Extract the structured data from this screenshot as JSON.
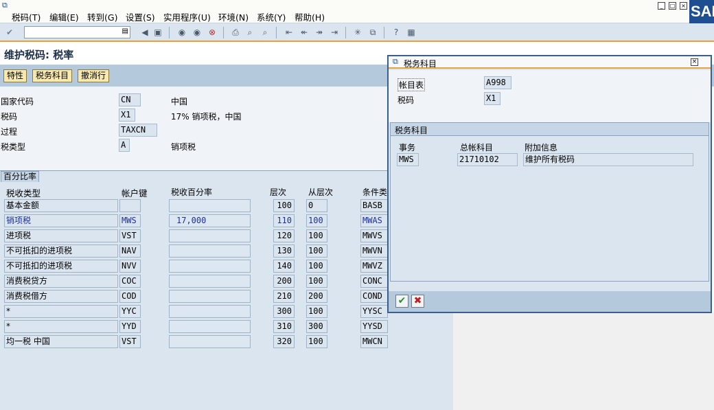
{
  "menu": {
    "items": [
      "税码(T)",
      "编辑(E)",
      "转到(G)",
      "设置(S)",
      "实用程序(U)",
      "环境(N)",
      "系统(Y)",
      "帮助(H)"
    ]
  },
  "logo_text": "SAP",
  "page_title": "维护税码: 税率",
  "app_buttons": [
    "特性",
    "税务科目",
    "撤消行"
  ],
  "header": {
    "country_label": "国家代码",
    "country_value": "CN",
    "country_desc": "中国",
    "taxcode_label": "税码",
    "taxcode_value": "X1",
    "taxcode_desc": "17% 销项税，中国",
    "procedure_label": "过程",
    "procedure_value": "TAXCN",
    "taxtype_label": "税类型",
    "taxtype_value": "A",
    "taxtype_desc": "销项税"
  },
  "table": {
    "tab_label": "百分比率",
    "columns": [
      "税收类型",
      "帐户键",
      "税收百分率",
      "层次",
      "从层次",
      "条件类"
    ],
    "rows": [
      {
        "type": "基本金额",
        "key": "",
        "pct": "",
        "level": "100",
        "from": "0",
        "cond": "BASB",
        "hl": false
      },
      {
        "type": "销项税",
        "key": "MWS",
        "pct": "17,000",
        "level": "110",
        "from": "100",
        "cond": "MWAS",
        "hl": true
      },
      {
        "type": "进项税",
        "key": "VST",
        "pct": "",
        "level": "120",
        "from": "100",
        "cond": "MWVS",
        "hl": false
      },
      {
        "type": "不可抵扣的进项税",
        "key": "NAV",
        "pct": "",
        "level": "130",
        "from": "100",
        "cond": "MWVN",
        "hl": false
      },
      {
        "type": "不可抵扣的进项税",
        "key": "NVV",
        "pct": "",
        "level": "140",
        "from": "100",
        "cond": "MWVZ",
        "hl": false
      },
      {
        "type": "消费税贷方",
        "key": "COC",
        "pct": "",
        "level": "200",
        "from": "100",
        "cond": "CONC",
        "hl": false
      },
      {
        "type": "消费税借方",
        "key": "COD",
        "pct": "",
        "level": "210",
        "from": "200",
        "cond": "COND",
        "hl": false
      },
      {
        "type": "*",
        "key": "YYC",
        "pct": "",
        "level": "300",
        "from": "100",
        "cond": "YYSC",
        "hl": false
      },
      {
        "type": "*",
        "key": "YYD",
        "pct": "",
        "level": "310",
        "from": "300",
        "cond": "YYSD",
        "hl": false
      },
      {
        "type": "均一税 中国",
        "key": "VST",
        "pct": "",
        "level": "320",
        "from": "100",
        "cond": "MWCN",
        "hl": false
      }
    ]
  },
  "dialog": {
    "title": "税务科目",
    "chart_label": "帐目表",
    "chart_value": "A998",
    "taxcode_label": "税码",
    "taxcode_value": "X1",
    "section_label": "税务科目",
    "col_tx": "事务",
    "col_account": "总帐科目",
    "col_info": "附加信息",
    "row_tx": "MWS",
    "row_account": "21710102",
    "row_info": "维护所有税码"
  },
  "colors": {
    "accent": "#e8a23c",
    "highlight_text": "#1a2fa0",
    "toolbar_bg": "#dbe5ef"
  }
}
